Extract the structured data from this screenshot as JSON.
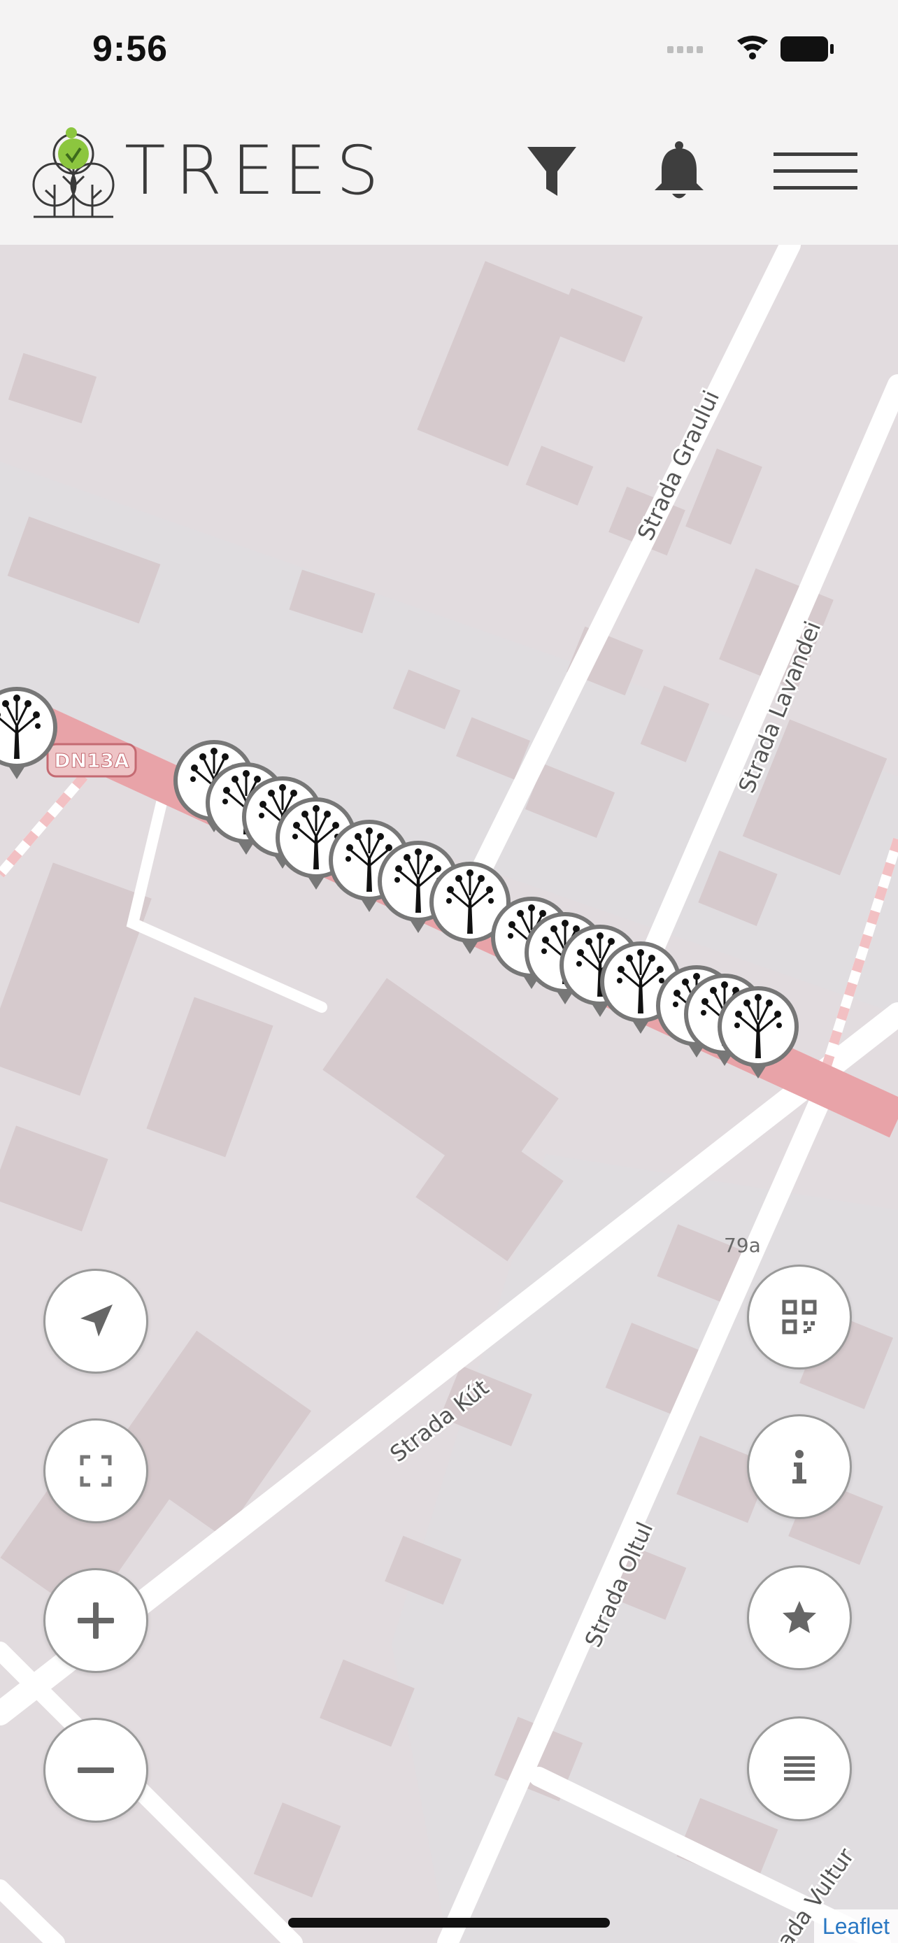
{
  "status_bar": {
    "time": "9:56"
  },
  "app": {
    "title": "TREES"
  },
  "header": {
    "buttons": [
      {
        "name": "filter-button",
        "icon": "filter-icon"
      },
      {
        "name": "notifications-button",
        "icon": "bell-icon"
      },
      {
        "name": "menu-button",
        "icon": "hamburger-menu-icon"
      }
    ]
  },
  "map": {
    "road_labels": [
      {
        "id": "graului",
        "text": "Strada Graului"
      },
      {
        "id": "lavandei",
        "text": "Strada Lavandei"
      },
      {
        "id": "kut",
        "text": "Strada Kút"
      },
      {
        "id": "oltul",
        "text": "Strada Oltul"
      },
      {
        "id": "vultur",
        "text": "ada Vultur"
      }
    ],
    "road_shield": "DN13A",
    "house_number": "79a",
    "tree_markers_count": 17,
    "attribution": "Leaflet",
    "colors": {
      "landuse": "#e2dcdf",
      "building": "#d5cacd",
      "main_road": "#e8a3a8",
      "residential_road": "#ffffff",
      "marker_border": "#777777"
    }
  },
  "controls": {
    "left": [
      {
        "name": "locate-button",
        "icon": "navigation-arrow-icon"
      },
      {
        "name": "fullscreen-button",
        "icon": "fullscreen-icon"
      },
      {
        "name": "zoom-in-button",
        "icon": "plus-icon"
      },
      {
        "name": "zoom-out-button",
        "icon": "minus-icon"
      }
    ],
    "right": [
      {
        "name": "qr-code-button",
        "icon": "qr-code-icon"
      },
      {
        "name": "info-button",
        "icon": "info-icon"
      },
      {
        "name": "favorites-button",
        "icon": "star-icon"
      },
      {
        "name": "list-button",
        "icon": "list-icon"
      }
    ]
  }
}
